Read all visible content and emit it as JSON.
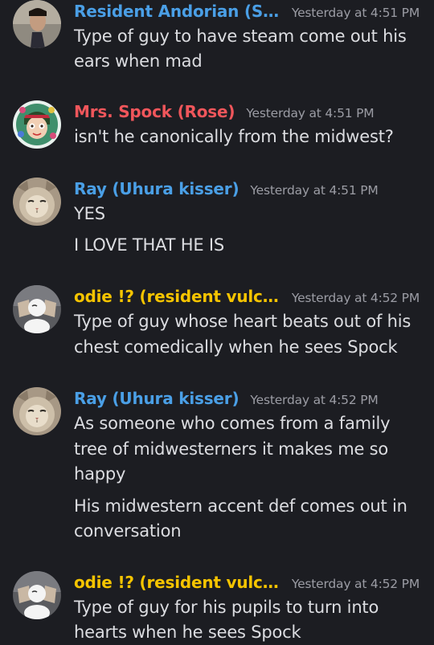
{
  "colors": {
    "background": "#1c1d22",
    "name_blue": "#4a9fe6",
    "name_red": "#f0565b",
    "name_yellow": "#f5c400",
    "timestamp": "#9b9ca4",
    "text": "#dcdde1"
  },
  "messages": [
    {
      "author": "Resident Andorian (S...",
      "author_color": "#4a9fe6",
      "timestamp": "Yesterday at 4:51 PM",
      "avatar": "spock-photo-avatar",
      "lines": [
        "Type of guy to have steam come out his",
        "ears when mad"
      ]
    },
    {
      "author": "Mrs. Spock (Rose)",
      "author_color": "#f0565b",
      "timestamp": "Yesterday at 4:51 PM",
      "avatar": "cartoon-girl-avatar",
      "lines": [
        "isn't he canonically from the midwest?"
      ]
    },
    {
      "author": "Ray (Uhura kisser)",
      "author_color": "#4a9fe6",
      "timestamp": "Yesterday at 4:51 PM",
      "avatar": "cat-face-avatar",
      "lines": [
        "YES",
        "I LOVE THAT HE IS"
      ]
    },
    {
      "author": "odie !? (resident vulc...",
      "author_color": "#f5c400",
      "timestamp": "Yesterday at 4:52 PM",
      "avatar": "odie-avatar",
      "lines": [
        "Type of guy whose heart beats out of his",
        "chest comedically when he sees Spock"
      ]
    },
    {
      "author": "Ray (Uhura kisser)",
      "author_color": "#4a9fe6",
      "timestamp": "Yesterday at 4:52 PM",
      "avatar": "cat-face-avatar",
      "lines": [
        "As someone who comes from a family",
        "tree of midwesterners it makes me so",
        "happy",
        "His midwestern accent def comes out in",
        "conversation"
      ]
    },
    {
      "author": "odie !? (resident vulc...",
      "author_color": "#f5c400",
      "timestamp": "Yesterday at 4:52 PM",
      "avatar": "odie-avatar",
      "lines": [
        "Type of guy for his pupils to turn into",
        "hearts when he sees Spock"
      ]
    }
  ]
}
